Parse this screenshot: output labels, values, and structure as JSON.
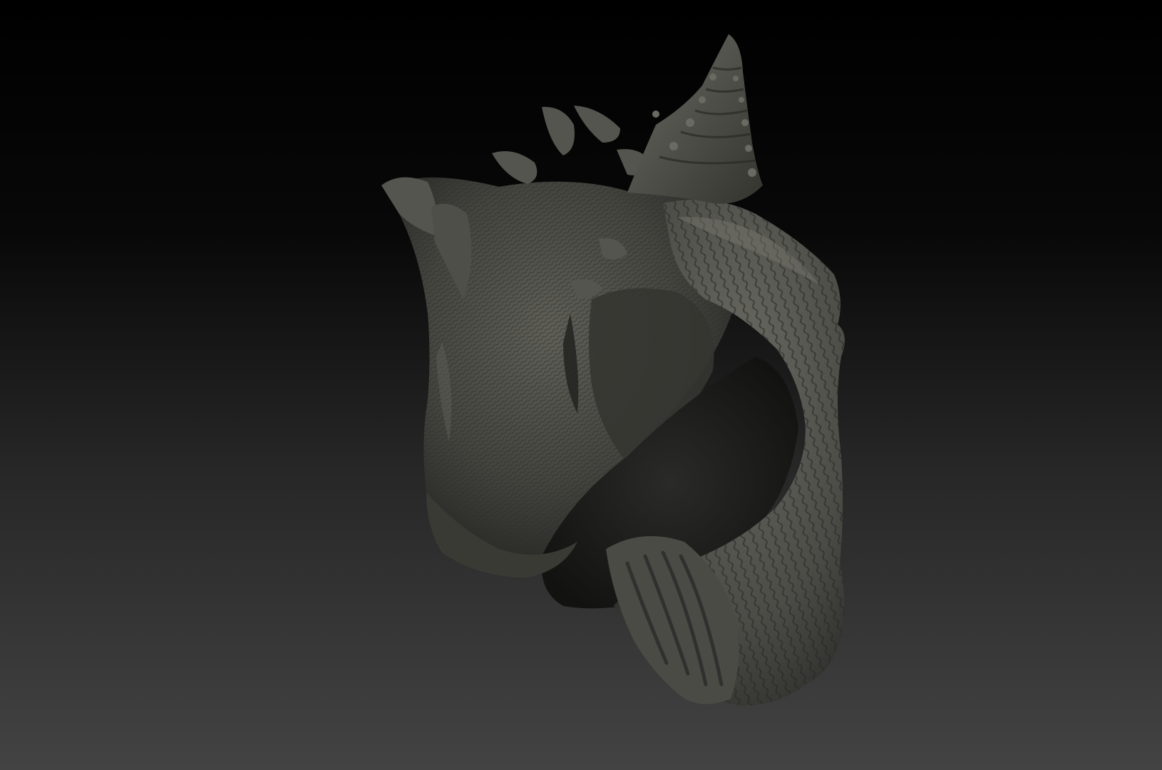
{
  "scene": {
    "background_top": "#000000",
    "background_bottom": "#434343",
    "model_color": "#4a4a45",
    "model_highlight": "#6b6b64",
    "model_shadow": "#1e1e1c",
    "model_subject": "conch-shell-sculpt"
  }
}
